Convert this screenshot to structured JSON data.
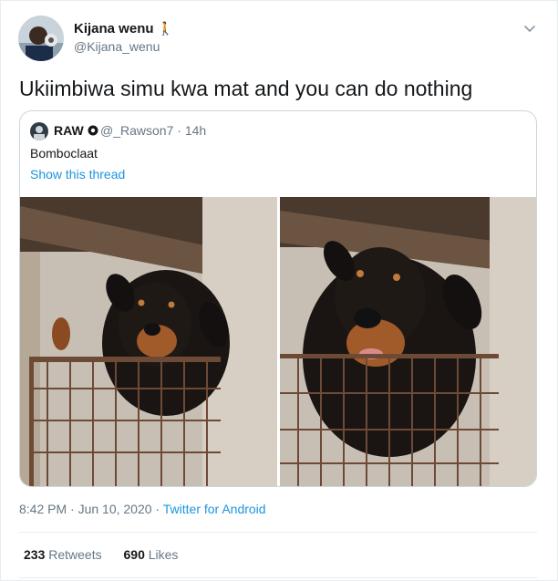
{
  "author": {
    "name": "Kijana wenu",
    "emoji": "🚶",
    "handle": "@Kijana_wenu"
  },
  "tweet": {
    "text": "Ukiimbiwa simu kwa mat and you can do nothing"
  },
  "quoted": {
    "name": "RAW",
    "handle": "@_Rawson7",
    "time": "14h",
    "text": "Bomboclaat",
    "thread_link": "Show this thread"
  },
  "footer": {
    "time": "8:42 PM · Jun 10, 2020",
    "separator": " · ",
    "source": "Twitter for Android"
  },
  "stats": {
    "retweets_count": "233",
    "retweets_label": "Retweets",
    "likes_count": "690",
    "likes_label": "Likes"
  },
  "icons": {
    "menu": "chevron-down-icon",
    "verified": "verified-badge-icon"
  },
  "colors": {
    "link": "#1b95e0",
    "secondary_text": "#657786",
    "border": "#ccd6dd"
  }
}
